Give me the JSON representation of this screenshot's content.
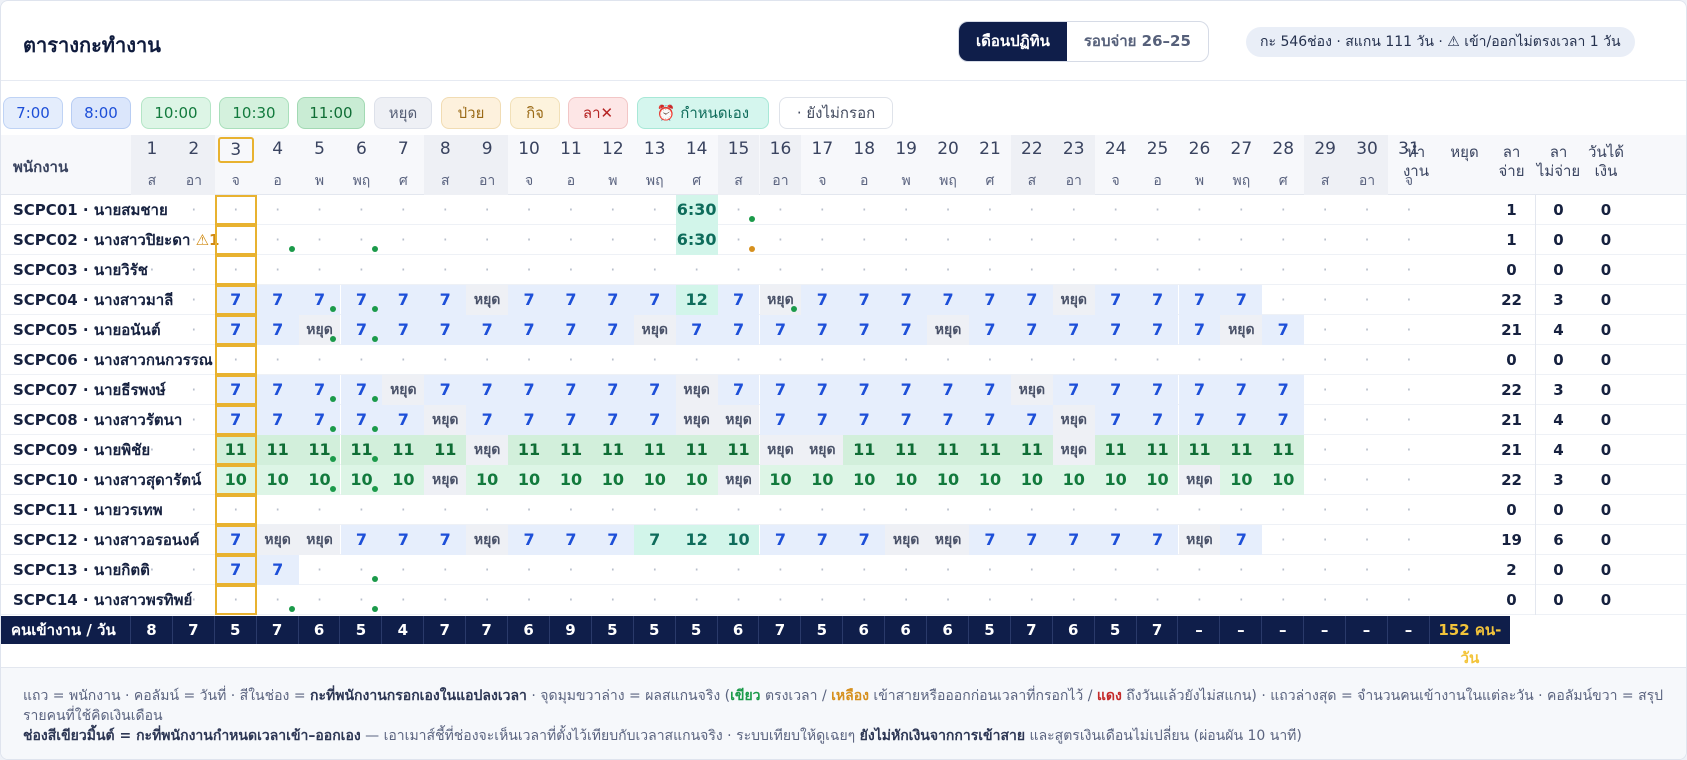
{
  "header": {
    "title": "ตารางกะทำงาน",
    "seg_calendar": "เดือนปฏิทิน",
    "seg_pay": "รอบจ่าย 26–25",
    "summary": "กะ 546ช่อง · สแกน 111 วัน · ⚠ เข้า/ออกไม่ตรงเวลา 1 วัน"
  },
  "legend": [
    {
      "label": "7:00",
      "kind": "c7"
    },
    {
      "label": "8:00",
      "kind": "c8"
    },
    {
      "label": "10:00",
      "kind": "c10"
    },
    {
      "label": "10:30",
      "kind": "c1030"
    },
    {
      "label": "11:00",
      "kind": "c11"
    },
    {
      "label": "หยุด",
      "kind": "coff"
    },
    {
      "label": "ป่วย",
      "kind": "csick"
    },
    {
      "label": "กิจ",
      "kind": "cbiz"
    },
    {
      "label": "ลา✕",
      "kind": "cleave"
    },
    {
      "label": "⏰ กำหนดเอง",
      "kind": "ccust"
    },
    {
      "label": "· ยังไม่กรอก",
      "kind": "cnone"
    }
  ],
  "table": {
    "employee_header": "พนักงาน",
    "days": [
      "1",
      "2",
      "3",
      "4",
      "5",
      "6",
      "7",
      "8",
      "9",
      "10",
      "11",
      "12",
      "13",
      "14",
      "15",
      "16",
      "17",
      "18",
      "19",
      "20",
      "21",
      "22",
      "23",
      "24",
      "25",
      "26",
      "27",
      "28",
      "29",
      "30",
      "31"
    ],
    "weekdays": [
      "ส",
      "อา",
      "จ",
      "อ",
      "พ",
      "พฤ",
      "ศ",
      "ส",
      "อา",
      "จ",
      "อ",
      "พ",
      "พฤ",
      "ศ",
      "ส",
      "อา",
      "จ",
      "อ",
      "พ",
      "พฤ",
      "ศ",
      "ส",
      "อา",
      "จ",
      "อ",
      "พ",
      "พฤ",
      "ศ",
      "ส",
      "อา",
      "จ"
    ],
    "summary_headers": [
      "ทำ\nงาน",
      "หยุด",
      "ลา\nจ่าย",
      "ลา\nไม่จ่าย",
      "วันได้\nเงิน"
    ],
    "rows": [
      {
        "name": "SCPC01 · นายสมชาย",
        "warn": "",
        "cells": ".,.,.,.,.,.,.,.,.,.,.,.,.,.,C6:30,.,.,.,.,.,.,.,.,.,.,.,.,.,.,.,.",
        "dots": {
          "15": "g"
        },
        "sum": [
          "",
          "",
          "",
          "1",
          "0",
          "0"
        ]
      },
      {
        "name": "SCPC02 · นางสาวปิยะดา",
        "warn": "⚠1",
        "cells": ".,.,.,.,.,.,.,.,.,.,.,.,.,.,C6:30,.,.,.,.,.,.,.,.,.,.,.,.,.,.,.,.",
        "dots": {
          "4": "g",
          "6": "g",
          "15": "y"
        },
        "sum": [
          "",
          "",
          "",
          "1",
          "0",
          "0"
        ]
      },
      {
        "name": "SCPC03 · นายวิรัช",
        "warn": "",
        "cells": ".,.,.,.,.,.,.,.,.,.,.,.,.,.,.,.,.,.,.,.,.,.,.,.,.,.,.,.,.,.,.",
        "dots": {},
        "sum": [
          "",
          "",
          "",
          "0",
          "0",
          "0"
        ]
      },
      {
        "name": "SCPC04 · นางสาวมาลี",
        "warn": "",
        "cells": ".,.,.,7,7,7,7,7,7,H,7,7,7,7,C12,7,H,7,7,7,7,7,7,H,7,7,7,7,.,.,.",
        "dots": {
          "5": "g",
          "6": "g",
          "16": "g"
        },
        "sum": [
          "",
          "",
          "",
          "22",
          "3",
          "0"
        ]
      },
      {
        "name": "SCPC05 · นายอนันต์",
        "warn": "",
        "cells": ".,.,.,7,7,H,7,7,7,7,7,7,7,H,7,7,7,7,7,7,H,7,7,7,7,7,7,H,7,.,.,.",
        "dots": {
          "5": "g",
          "6": "g"
        },
        "sum": [
          "",
          "",
          "",
          "21",
          "4",
          "0"
        ]
      },
      {
        "name": "SCPC06 · นางสาวกนกวรรณ",
        "warn": "",
        "cells": ".,.,.,.,.,.,.,.,.,.,.,.,.,.,.,.,.,.,.,.,.,.,.,.,.,.,.,.,.,.,.",
        "dots": {},
        "sum": [
          "",
          "",
          "",
          "0",
          "0",
          "0"
        ]
      },
      {
        "name": "SCPC07 · นายธีรพงษ์",
        "warn": "",
        "cells": ".,.,.,7,7,7,7,H,7,7,7,7,7,7,H,7,7,7,7,7,7,7,H,7,7,7,7,7,7,.,.,.",
        "dots": {
          "5": "g",
          "6": "g"
        },
        "sum": [
          "",
          "",
          "",
          "22",
          "3",
          "0"
        ]
      },
      {
        "name": "SCPC08 · นางสาวรัตนา",
        "warn": "",
        "cells": ".,.,.,7,7,7,7,7,H,7,7,7,7,7,H,H,7,7,7,7,7,7,7,H,7,7,7,7,7,.,.,.",
        "dots": {
          "5": "g",
          "6": "g"
        },
        "sum": [
          "",
          "",
          "",
          "21",
          "4",
          "0"
        ]
      },
      {
        "name": "SCPC09 · นายพิชัย",
        "warn": "",
        "cells": ".,.,.,11,11,11,11,11,11,H,11,11,11,11,11,11,H,H,11,11,11,11,11,H,11,11,11,11,11,.,.,.",
        "dots": {
          "5": "g",
          "6": "g"
        },
        "sum": [
          "",
          "",
          "",
          "21",
          "4",
          "0"
        ]
      },
      {
        "name": "SCPC10 · นางสาวสุดารัตน์",
        "warn": "",
        "cells": ".,.,.,10,10,10,10,10,H,10,10,10,10,10,10,H,10,10,10,10,10,10,10,10,10,10,H,10,10,.,.,.",
        "dots": {
          "5": "g",
          "6": "g"
        },
        "sum": [
          "",
          "",
          "",
          "22",
          "3",
          "0"
        ]
      },
      {
        "name": "SCPC11 · นายวรเทพ",
        "warn": "",
        "cells": ".,.,.,.,.,.,.,.,.,.,.,.,.,.,.,.,.,.,.,.,.,.,.,.,.,.,.,.,.,.,.",
        "dots": {},
        "sum": [
          "",
          "",
          "",
          "0",
          "0",
          "0"
        ]
      },
      {
        "name": "SCPC12 · นางสาวอรอนงค์",
        "warn": "",
        "cells": ".,.,.,7,H,H,7,7,7,H,7,7,7,C7,C12,C10,7,7,7,H,H,7,7,7,7,7,H,7,.,.,.,.",
        "dots": {},
        "sum": [
          "",
          "",
          "",
          "19",
          "6",
          "0"
        ]
      },
      {
        "name": "SCPC13 · นายกิตติ",
        "warn": "",
        "cells": ".,.,.,7,7,.,.,.,.,.,.,.,.,.,.,.,.,.,.,.,.,.,.,.,.,.,.,.,.,.,.",
        "dots": {
          "6": "g"
        },
        "sum": [
          "",
          "",
          "",
          "2",
          "0",
          "0"
        ]
      },
      {
        "name": "SCPC14 · นางสาวพรทิพย์",
        "warn": "",
        "cells": ".,.,.,.,.,.,.,.,.,.,.,.,.,.,.,.,.,.,.,.,.,.,.,.,.,.,.,.,.,.,.",
        "dots": {
          "4": "g",
          "6": "g"
        },
        "sum": [
          "",
          "",
          "",
          "0",
          "0",
          "0"
        ]
      }
    ],
    "footer_label": "คนเข้างาน / วัน",
    "footer_counts": [
      "8",
      "7",
      "5",
      "7",
      "6",
      "5",
      "4",
      "7",
      "7",
      "6",
      "9",
      "5",
      "5",
      "5",
      "6",
      "7",
      "5",
      "6",
      "6",
      "6",
      "5",
      "7",
      "6",
      "5",
      "7",
      "–",
      "–",
      "–",
      "–",
      "–",
      "–"
    ],
    "footer_total": "152 คน-วัน"
  },
  "notes": {
    "line1_a": "แถว = พนักงาน · คอลัมน์ = วันที่ · สีในช่อง = ",
    "line1_b": "กะที่พนักงานกรอกเองในแอปลงเวลา",
    "line1_c": " · จุดมุมขวาล่าง = ผลสแกนจริง (",
    "green": "เขียว",
    "line1_d": " ตรงเวลา / ",
    "yellow": "เหลือง",
    "line1_e": " เข้าสายหรือออกก่อนเวลาที่กรอกไว้ / ",
    "red": "แดง",
    "line1_f": " ถึงวันแล้วยังไม่สแกน) · แถวล่างสุด = จำนวนคนเข้างานในแต่ละวัน · คอลัมน์ขวา = สรุปรายคนที่ใช้คิดเงินเดือน",
    "line2_a": "ช่องสีเขียวมิ้นต์ = กะที่พนักงานกำหนดเวลาเข้า–ออกเอง",
    "line2_b": " — เอาเมาส์ชี้ที่ช่องจะเห็นเวลาที่ตั้งไว้เทียบกับเวลาสแกนจริง · ระบบเทียบให้ดูเฉยๆ ",
    "line2_c": "ยังไม่หักเงินจากการเข้าสาย",
    "line2_d": " และสูตรเงินเดือนไม่เปลี่ยน (ผ่อนผัน 10 นาที)"
  }
}
